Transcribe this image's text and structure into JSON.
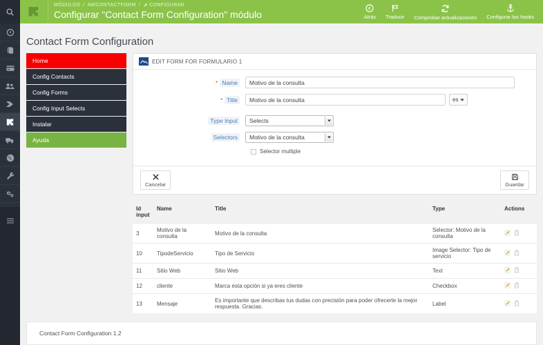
{
  "rail": {
    "search_icon": "search-icon",
    "items": [
      {
        "icon": "dashboard-gauge-icon",
        "name": "dashboard",
        "active": false
      },
      {
        "icon": "catalog-book-icon",
        "name": "catalog",
        "active": false
      },
      {
        "icon": "orders-card-icon",
        "name": "orders",
        "active": false
      },
      {
        "icon": "customers-people-icon",
        "name": "customers",
        "active": false
      },
      {
        "icon": "price-rules-tag-icon",
        "name": "price-rules",
        "active": false
      },
      {
        "icon": "modules-puzzle-icon",
        "name": "modules",
        "active": true
      },
      {
        "icon": "shipping-truck-icon",
        "name": "shipping",
        "active": false
      },
      {
        "icon": "localization-globe-icon",
        "name": "localization",
        "active": false
      },
      {
        "icon": "preferences-wrench-icon",
        "name": "preferences",
        "active": false
      },
      {
        "icon": "advanced-parameters-gears-icon",
        "name": "advanced-parameters",
        "active": false
      },
      {
        "icon": "administration-gear-icon",
        "name": "administration",
        "active": false
      },
      {
        "icon": "stats-bar-chart-icon",
        "name": "stats",
        "active": false
      }
    ],
    "menu_icon": "hamburger-menu-icon"
  },
  "topbar": {
    "module_icon": "puzzle-icon",
    "breadcrumb": {
      "level1": "MÓDULOS",
      "sep1": "/",
      "level2": "AWCONTACTFORM",
      "sep2": "/",
      "level3": "CONFIGURAR",
      "level3_icon": "wrench-icon"
    },
    "title": "Configurar \"Contact Form Configuration\" módulo",
    "actions": [
      {
        "icon": "back-arrow-circle-icon",
        "label": "Atrás"
      },
      {
        "icon": "translate-flag-icon",
        "label": "Traducir"
      },
      {
        "icon": "refresh-sync-icon",
        "label": "Comprobar actualizaciones"
      },
      {
        "icon": "anchor-hooks-icon",
        "label": "Configurar los hooks"
      }
    ]
  },
  "page": {
    "title": "Contact Form Configuration"
  },
  "sidemenu": {
    "items": [
      {
        "label": "Home",
        "state": "red"
      },
      {
        "label": "Config Contacts",
        "state": "dark"
      },
      {
        "label": "Config Forms",
        "state": "dark"
      },
      {
        "label": "Config Input Selects",
        "state": "dark"
      },
      {
        "label": "Instalar",
        "state": "dark"
      },
      {
        "label": "Ayuda",
        "state": "green"
      }
    ]
  },
  "panel": {
    "logo_icon": "module-logo-icon",
    "header": "EDIT FORM FOR FORMULARIO 1",
    "fields": {
      "name": {
        "label": "Name",
        "required": true,
        "value": "Motivo de la consulta",
        "placeholder": ""
      },
      "title": {
        "label": "Title",
        "required": true,
        "value": "Motivo de la consulta",
        "placeholder": "",
        "lang": "es"
      },
      "type_input": {
        "label": "Type Input",
        "value": "Selects"
      },
      "selectors": {
        "label": "Selectors",
        "value": "Motivo de la consulta"
      },
      "selector_multiple": {
        "label": "Selector multiple",
        "checked": false
      }
    },
    "buttons": {
      "cancel": {
        "label": "Cancelar",
        "icon": "close-x-icon"
      },
      "save": {
        "label": "Guardar",
        "icon": "floppy-save-icon"
      }
    }
  },
  "table": {
    "columns": [
      "Id input",
      "Name",
      "Title",
      "Type",
      "Actions"
    ],
    "rows": [
      {
        "id": "3",
        "name": "Motivo de la consulta",
        "title": "Motivo de la consulta",
        "type": "Selector: Motivo de la consulta"
      },
      {
        "id": "10",
        "name": "TipodeServicio",
        "title": "Tipo de Servicio",
        "type": "Image Selector: Tipo de servicio"
      },
      {
        "id": "11",
        "name": "Sitio Web",
        "title": "Sitio Web",
        "type": "Text"
      },
      {
        "id": "12",
        "name": "cliente",
        "title": "Marca esta opción si ya eres cliente",
        "type": "Checkbox"
      },
      {
        "id": "13",
        "name": "Mensaje",
        "title": "Es importante que describas tus dudas con precisión para poder ofrecerte la mejor respuesta. Gracias.",
        "type": "Label"
      }
    ],
    "row_actions": {
      "edit_icon": "edit-pencil-icon",
      "delete_icon": "delete-trash-icon"
    }
  },
  "footer": {
    "text": "Contact Form Configuration 1.2"
  },
  "colors": {
    "header_green": "#8bc349",
    "menu_red": "#f90000",
    "menu_green": "#79b343",
    "menu_dark": "#2b313b",
    "rail_dark": "#2b313b",
    "label_blue": "#4a7fb5",
    "required_star": "#e8442c",
    "panel_logo_blue": "#1c4b8b",
    "edit_icon_yellow": "#e8b231",
    "page_bg": "#f1f1f1"
  }
}
